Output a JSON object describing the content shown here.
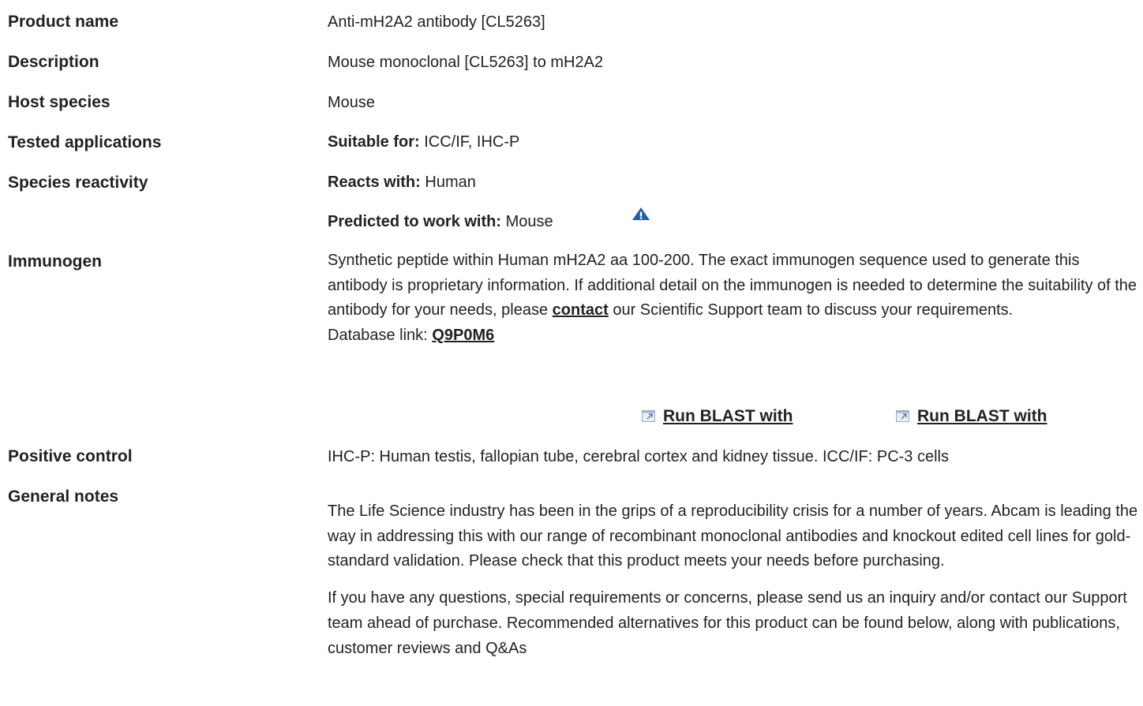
{
  "rows": {
    "product_name": {
      "label": "Product name",
      "value": "Anti-mH2A2 antibody [CL5263]"
    },
    "description": {
      "label": "Description",
      "value": "Mouse monoclonal [CL5263] to mH2A2"
    },
    "host_species": {
      "label": "Host species",
      "value": "Mouse"
    },
    "tested_applications": {
      "label": "Tested applications",
      "prefix": "Suitable for:",
      "value": "ICC/IF, IHC-P"
    },
    "species_reactivity": {
      "label": "Species reactivity",
      "reacts_prefix": "Reacts with:",
      "reacts_value": "Human",
      "predicted_prefix": "Predicted to work with:",
      "predicted_value": "Mouse",
      "warning_icon": "warning-triangle-icon"
    },
    "immunogen": {
      "label": "Immunogen",
      "text_before_link": "Synthetic peptide within Human mH2A2 aa 100-200. The exact immunogen sequence used to generate this antibody is proprietary information. If additional detail on the immunogen is needed to determine the suitability of the antibody for your needs, please",
      "link_text": "contact",
      "text_after_link": "our Scientific Support team to discuss your requirements.",
      "database_prefix": "Database link:",
      "database_link": "Q9P0M6",
      "blast_1": "Run BLAST with",
      "blast_2": "Run BLAST with",
      "blast_icon": "external-window-icon"
    },
    "positive_control": {
      "label": "Positive control",
      "value": "IHC-P: Human testis, fallopian tube, cerebral cortex and kidney tissue. ICC/IF: PC-3 cells"
    },
    "general_notes": {
      "label": "General notes",
      "paragraph_1": "The Life Science industry has been in the grips of a reproducibility crisis for a number of years. Abcam is leading the way in addressing this with our range of recombinant monoclonal antibodies and knockout edited cell lines for gold-standard validation. Please check that this product meets your needs before purchasing.",
      "paragraph_2": "If you have any questions, special requirements or concerns, please send us an inquiry and/or contact our Support team ahead of purchase. Recommended alternatives for this product can be found below, along with publications, customer reviews and Q&As"
    }
  },
  "colors": {
    "text": "#222222",
    "warning_icon": "#1f5fa8"
  }
}
